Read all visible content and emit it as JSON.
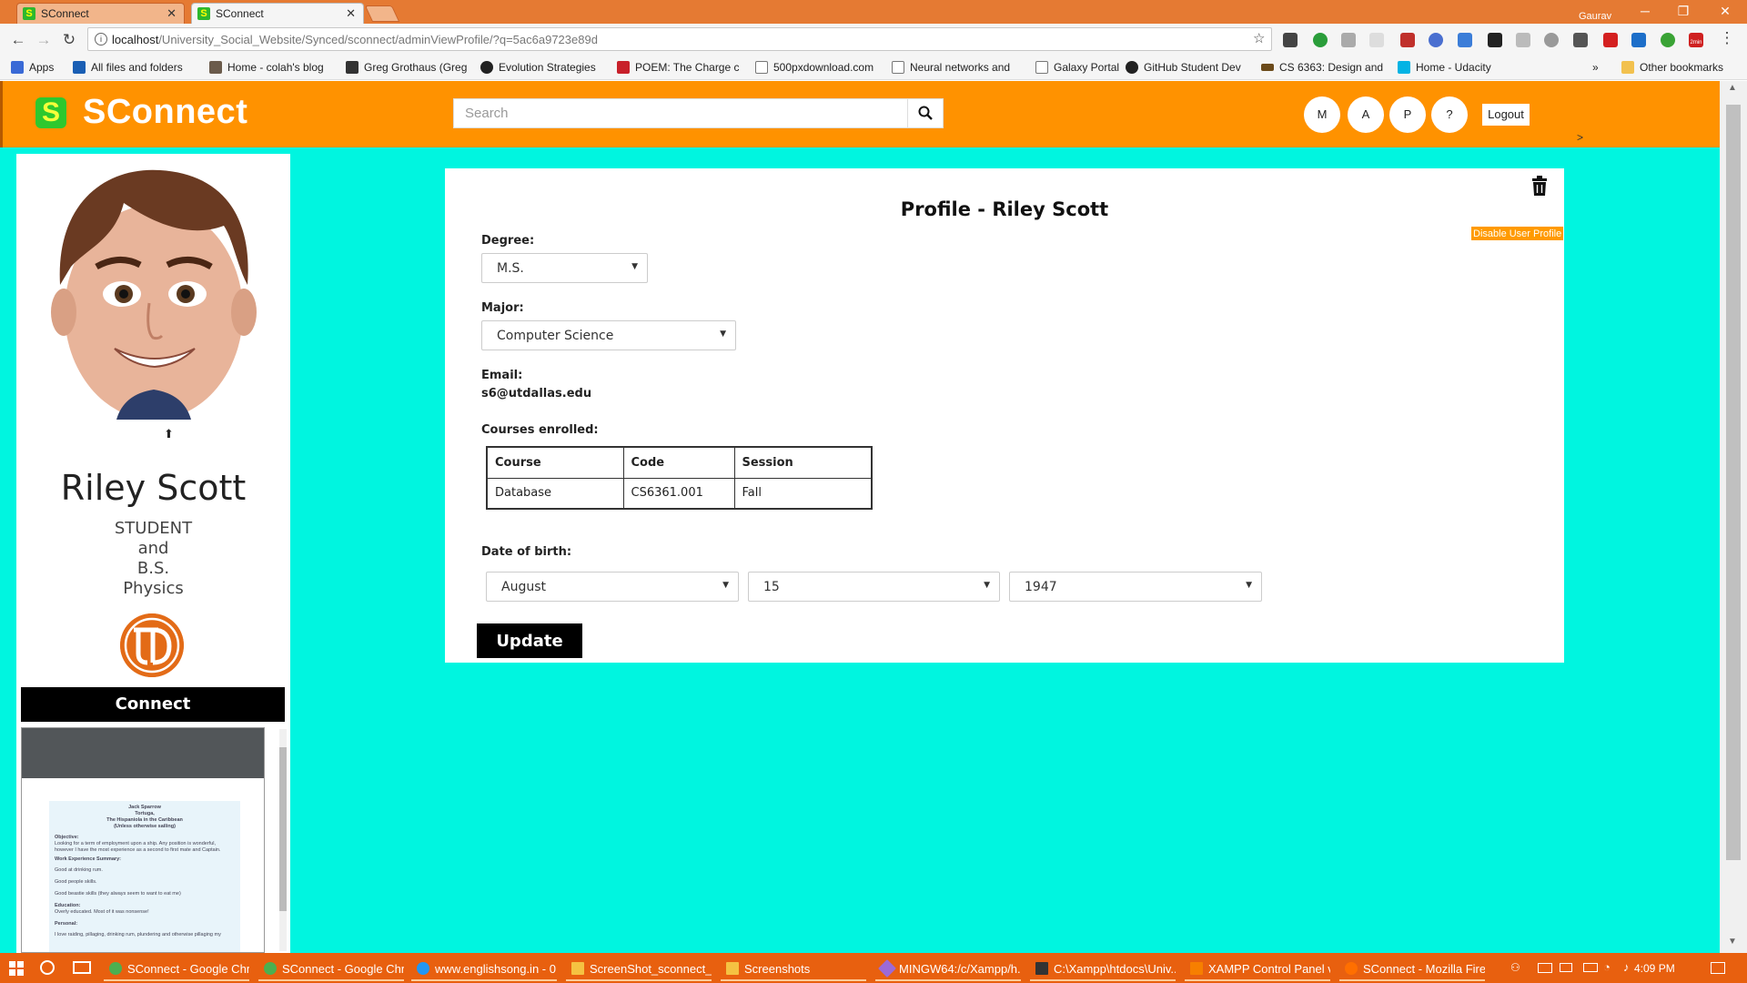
{
  "browser": {
    "tabs": [
      {
        "title": "SConnect",
        "active": false
      },
      {
        "title": "SConnect",
        "active": true
      }
    ],
    "user": "Gaurav",
    "url_host": "localhost",
    "url_path": "/University_Social_Website/Synced/sconnect/adminViewProfile/?q=5ac6a9723e89d",
    "bookmarks": [
      "Apps",
      "All files and folders",
      "Home - colah's blog",
      "Greg Grothaus (Greg",
      "Evolution Strategies",
      "POEM: The Charge c",
      "500pxdownload.com",
      "Neural networks and",
      "Galaxy Portal",
      "GitHub Student Dev",
      "CS 6363: Design and",
      "Home - Udacity"
    ],
    "other_bookmarks": "Other bookmarks",
    "more_bookmarks": "»",
    "ext_badge": "2min"
  },
  "navbar": {
    "brand_letter": "S",
    "brand_name": "SConnect",
    "search_placeholder": "Search",
    "circle_buttons": [
      "M",
      "A",
      "P",
      "?"
    ],
    "logout": "Logout"
  },
  "sidebar": {
    "name": "Riley Scott",
    "role_lines": [
      "STUDENT",
      "and",
      "B.S.",
      "Physics"
    ],
    "connect": "Connect",
    "resume": {
      "header_lines": [
        "Jack Sparrow",
        "Tortuga,",
        "The Hispaniola in the Caribbean",
        "(Unless otherwise sailing)"
      ],
      "sections": [
        {
          "heading": "Objective:",
          "text": "Looking for a term of employment upon a ship. Any position is wonderful, however I have the most experience as a second to first mate and Captain."
        },
        {
          "heading": "Work Experience Summary:",
          "text": "Good at drinking rum."
        },
        {
          "heading": "",
          "text": "Good people skills."
        },
        {
          "heading": "",
          "text": "Good beastie skills (they always seem to want to eat me)"
        },
        {
          "heading": "Education:",
          "text": "Overly educated. Most of it was nonsense!"
        },
        {
          "heading": "Personal:",
          "text": "I love raiding, pillaging, drinking rum, plundering and otherwise pillaging my"
        }
      ]
    }
  },
  "profile": {
    "title": "Profile - Riley Scott",
    "disable_button": "Disable User Profile",
    "degree_label": "Degree:",
    "degree_value": "M.S.",
    "major_label": "Major:",
    "major_value": "Computer Science",
    "email_label": "Email:",
    "email_value": "s6@utdallas.edu",
    "courses_label": "Courses enrolled:",
    "courses_headers": [
      "Course",
      "Code",
      "Session"
    ],
    "courses_rows": [
      [
        "Database",
        "CS6361.001",
        "Fall"
      ]
    ],
    "dob_label": "Date of birth:",
    "dob_month": "August",
    "dob_day": "15",
    "dob_year": "1947",
    "update_button": "Update",
    "collapse_glyph": ">"
  },
  "taskbar": {
    "items": [
      "SConnect - Google Chr...",
      "SConnect - Google Chr...",
      "www.englishsong.in - 0...",
      "ScreenShot_sconnect_N...",
      "Screenshots",
      "MINGW64:/c/Xampp/h...",
      "C:\\Xampp\\htdocs\\Univ...",
      "XAMPP Control Panel v...",
      "SConnect - Mozilla Firef..."
    ],
    "clock": "4:09 PM"
  },
  "colors": {
    "navbar": "#ff9200",
    "page_bg": "#00f5e0",
    "tab_strip": "#e57a33",
    "taskbar": "#e8600f",
    "disable_button": "#ff9a00"
  }
}
